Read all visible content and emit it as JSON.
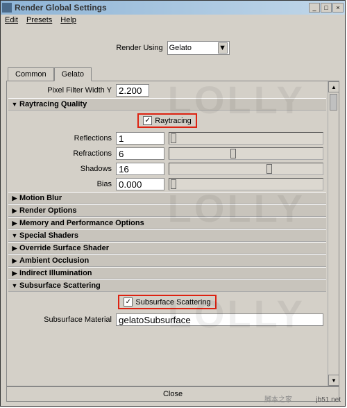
{
  "window": {
    "title": "Render Global Settings"
  },
  "menu": {
    "edit": "Edit",
    "presets": "Presets",
    "help": "Help"
  },
  "renderRow": {
    "label": "Render Using",
    "value": "Gelato"
  },
  "tabs": {
    "common": "Common",
    "gelato": "Gelato"
  },
  "pixelFilter": {
    "label": "Pixel Filter Width Y",
    "value": "2.200"
  },
  "raytracing": {
    "header": "Raytracing Quality",
    "toggle": "Raytracing",
    "reflections_label": "Reflections",
    "reflections": "1",
    "refractions_label": "Refractions",
    "refractions": "6",
    "shadows_label": "Shadows",
    "shadows": "16",
    "bias_label": "Bias",
    "bias": "0.000"
  },
  "sections": {
    "motion_blur": "Motion Blur",
    "render_options": "Render Options",
    "memory": "Memory and Performance Options",
    "special_shaders": "Special Shaders",
    "override_surface": "Override Surface Shader",
    "ambient_occ": "Ambient Occlusion",
    "indirect": "Indirect Illumination",
    "sss_header": "Subsurface Scattering"
  },
  "sss": {
    "toggle": "Subsurface Scattering",
    "material_label": "Subsurface Material",
    "material_value": "gelatoSubsurface"
  },
  "close": "Close",
  "watermark": {
    "lolly": "LOLLY",
    "site1": "脚本之家",
    "site2": "jb51.net"
  }
}
